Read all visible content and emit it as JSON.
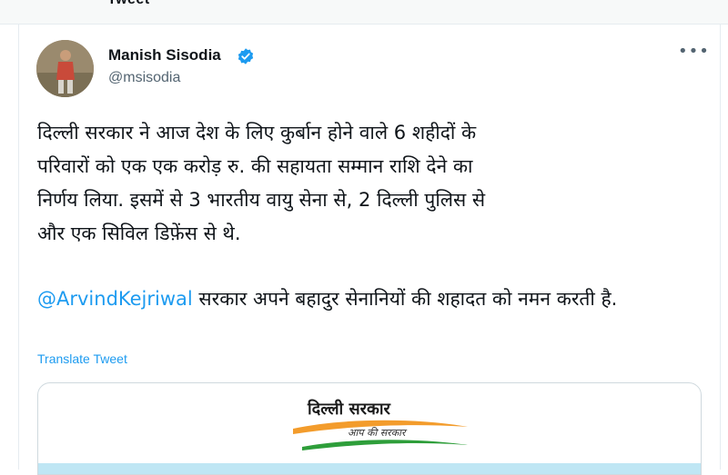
{
  "header": {
    "partial_text": "Tweet"
  },
  "author": {
    "name": "Manish Sisodia",
    "handle": "@msisodia",
    "verified": true
  },
  "tweet": {
    "body": "दिल्ली सरकार ने आज देश के लिए कुर्बान होने वाले 6 शहीदों के\nपरिवारों को एक एक करोड़ रु. की सहायता सम्मान राशि देने का\nनिर्णय लिया. इसमें से 3 भारतीय वायु सेना से, 2 दिल्ली पुलिस से\nऔर एक सिविल डिफ़ेंस से थे.",
    "mention": "@ArvindKejriwal",
    "mention_rest": " सरकार अपने बहादुर सेनानियों की शहादत को नमन करती है.",
    "translate_label": "Translate Tweet"
  },
  "media": {
    "logo_title": "दिल्ली सरकार",
    "logo_subtitle": "आप की सरकार"
  },
  "colors": {
    "link": "#1d9bf0",
    "verified": "#1d9bf0",
    "secondary_text": "#536471",
    "saffron": "#f39c2c",
    "green": "#2e9e3a"
  },
  "icons": {
    "verified": "verified-badge-icon",
    "more": "more-options-icon"
  }
}
